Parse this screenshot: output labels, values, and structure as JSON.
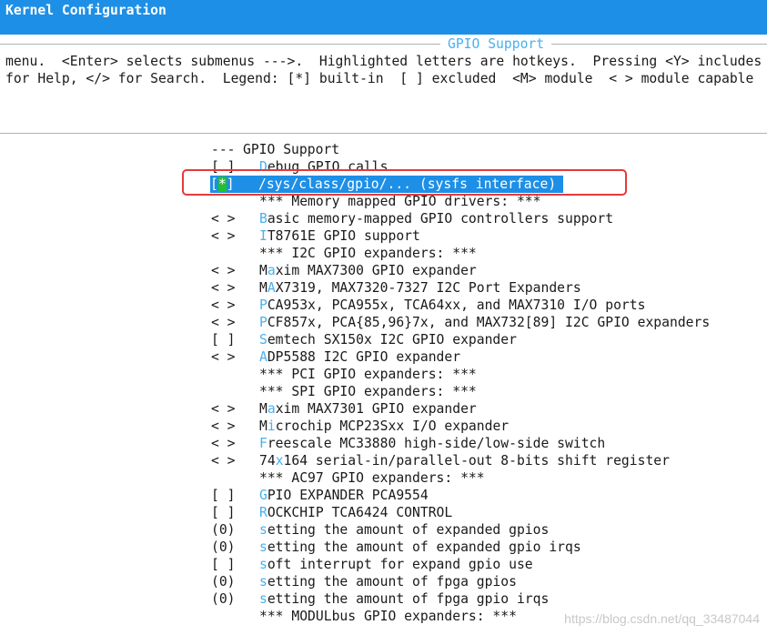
{
  "window": {
    "title": "Kernel Configuration"
  },
  "dialog": {
    "title": "GPIO Support",
    "help_lines": [
      "menu.  <Enter> selects submenus --->.  Highlighted letters are hotkeys.  Pressing <Y> includes",
      "for Help, </> for Search.  Legend: [*] built-in  [ ] excluded  <M> module  < > module capable"
    ]
  },
  "menu": {
    "items": [
      {
        "mark": "---",
        "hot": "",
        "rest": "GPIO Support"
      },
      {
        "mark": "[ ]",
        "hot": "D",
        "rest": "ebug GPIO calls"
      },
      {
        "mark": "[*]",
        "hot": "",
        "rest": "/sys/class/gpio/... (sysfs interface)",
        "selected": true
      },
      {
        "mark": "",
        "hot": "",
        "rest": "*** Memory mapped GPIO drivers: ***"
      },
      {
        "mark": "< >",
        "hot": "B",
        "rest": "asic memory-mapped GPIO controllers support"
      },
      {
        "mark": "< >",
        "hot": "I",
        "rest": "T8761E GPIO support"
      },
      {
        "mark": "",
        "hot": "",
        "rest": "*** I2C GPIO expanders: ***"
      },
      {
        "mark": "< >",
        "pre": "M",
        "hot": "a",
        "rest": "xim MAX7300 GPIO expander"
      },
      {
        "mark": "< >",
        "pre": "M",
        "hot": "A",
        "rest": "X7319, MAX7320-7327 I2C Port Expanders"
      },
      {
        "mark": "< >",
        "hot": "P",
        "rest": "CA953x, PCA955x, TCA64xx, and MAX7310 I/O ports"
      },
      {
        "mark": "< >",
        "hot": "P",
        "rest": "CF857x, PCA{85,96}7x, and MAX732[89] I2C GPIO expanders"
      },
      {
        "mark": "[ ]",
        "hot": "S",
        "rest": "emtech SX150x I2C GPIO expander"
      },
      {
        "mark": "< >",
        "hot": "A",
        "rest": "DP5588 I2C GPIO expander"
      },
      {
        "mark": "",
        "hot": "",
        "rest": "*** PCI GPIO expanders: ***"
      },
      {
        "mark": "",
        "hot": "",
        "rest": "*** SPI GPIO expanders: ***"
      },
      {
        "mark": "< >",
        "pre": "M",
        "hot": "a",
        "rest": "xim MAX7301 GPIO expander"
      },
      {
        "mark": "< >",
        "pre": "M",
        "hot": "i",
        "rest": "crochip MCP23Sxx I/O expander"
      },
      {
        "mark": "< >",
        "hot": "F",
        "rest": "reescale MC33880 high-side/low-side switch"
      },
      {
        "mark": "< >",
        "pre": "74",
        "hot": "x",
        "rest": "164 serial-in/parallel-out 8-bits shift register"
      },
      {
        "mark": "",
        "hot": "",
        "rest": "*** AC97 GPIO expanders: ***"
      },
      {
        "mark": "[ ]",
        "hot": "G",
        "rest": "PIO EXPANDER PCA9554"
      },
      {
        "mark": "[ ]",
        "hot": "R",
        "rest": "OCKCHIP TCA6424 CONTROL"
      },
      {
        "mark": "(0)",
        "hot": "s",
        "rest": "etting the amount of expanded gpios"
      },
      {
        "mark": "(0)",
        "hot": "s",
        "rest": "etting the amount of expanded gpio irqs"
      },
      {
        "mark": "[ ]",
        "hot": "s",
        "rest": "oft interrupt for expand gpio use"
      },
      {
        "mark": "(0)",
        "hot": "s",
        "rest": "etting the amount of fpga gpios"
      },
      {
        "mark": "(0)",
        "hot": "s",
        "rest": "etting the amount of fpga gpio irqs"
      },
      {
        "mark": "",
        "hot": "",
        "rest": "*** MODULbus GPIO expanders: ***"
      }
    ]
  },
  "watermark": "https://blog.csdn.net/qq_33487044",
  "colors": {
    "titlebar": "#1e8fe6",
    "hotkey": "#49b0ef",
    "selection": "#1e8fe6",
    "star": "#22c02a",
    "annotation_box": "#e53a3a"
  }
}
